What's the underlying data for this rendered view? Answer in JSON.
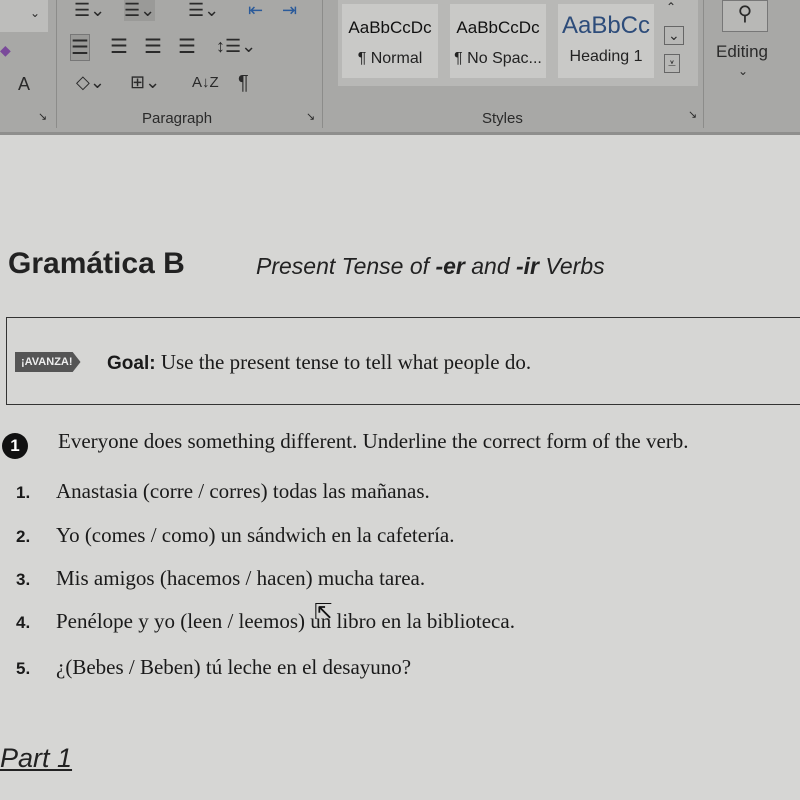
{
  "ribbon": {
    "font_grow_label": "A",
    "paragraph_group": "Paragraph",
    "styles_group": "Styles",
    "styles": [
      {
        "preview": "AaBbCcDc",
        "name": "¶ Normal"
      },
      {
        "preview": "AaBbCcDc",
        "name": "¶ No Spac..."
      },
      {
        "preview": "AaBbCc",
        "name": "Heading 1"
      }
    ],
    "editing_label": "Editing",
    "sort_label": "A↓Z",
    "pilcrow": "¶"
  },
  "document": {
    "title": "Gramática B",
    "subtitle_parts": [
      "Present Tense of ",
      "-er",
      " and ",
      "-ir",
      " Verbs"
    ],
    "badge": "¡AVANZA!",
    "goal_label": "Goal:",
    "goal_text": " Use the present tense to tell what people do.",
    "activity_number": "1",
    "instructions": "Everyone does something different. Underline the correct form of the verb.",
    "items": [
      {
        "num": "1.",
        "text": "Anastasia (corre / corres) todas las mañanas."
      },
      {
        "num": "2.",
        "text": "Yo (comes / como) un sándwich en la cafetería."
      },
      {
        "num": "3.",
        "text": "Mis amigos (hacemos / hacen) mucha tarea."
      },
      {
        "num": "4.",
        "text": "Penélope y yo (leen / leemos) un libro en la biblioteca."
      },
      {
        "num": "5.",
        "text": "¿(Bebes / Beben) tú leche en el desayuno?"
      }
    ],
    "part_label": "Part 1"
  }
}
